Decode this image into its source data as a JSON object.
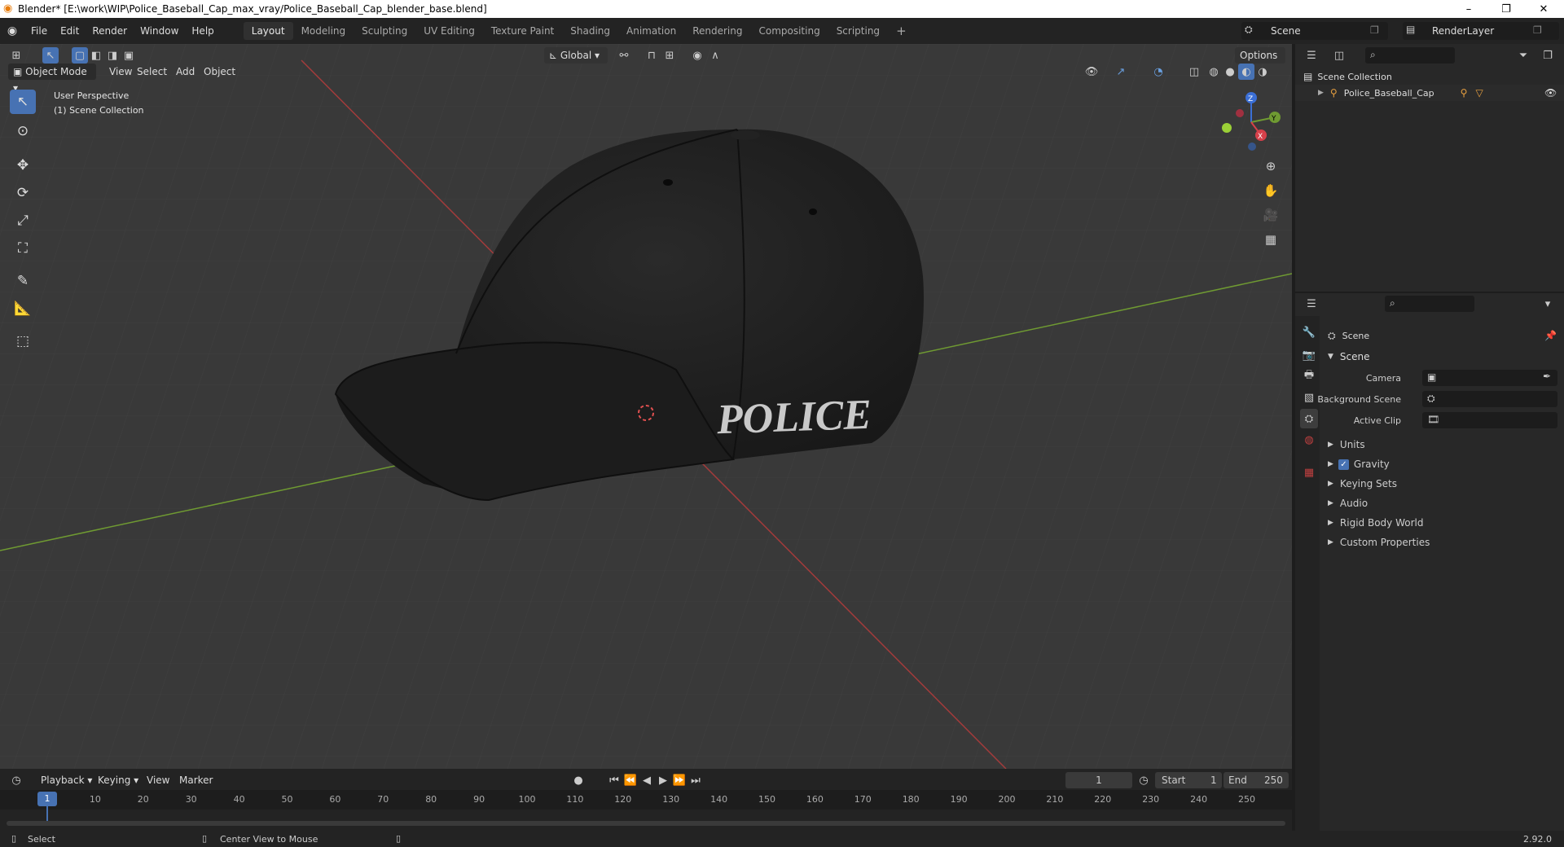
{
  "window": {
    "title": "Blender* [E:\\work\\WIP\\Police_Baseball_Cap_max_vray/Police_Baseball_Cap_blender_base.blend]",
    "minimize": "–",
    "maximize": "❐",
    "close": "✕"
  },
  "menus": [
    "File",
    "Edit",
    "Render",
    "Window",
    "Help"
  ],
  "workspaces": [
    "Layout",
    "Modeling",
    "Sculpting",
    "UV Editing",
    "Texture Paint",
    "Shading",
    "Animation",
    "Rendering",
    "Compositing",
    "Scripting"
  ],
  "active_workspace": "Layout",
  "add_tab": "+",
  "scene_selector": {
    "value": "Scene"
  },
  "renderlayer_selector": {
    "value": "RenderLayer"
  },
  "viewport": {
    "mode": "Object Mode",
    "menu": [
      "View",
      "Select",
      "Add",
      "Object"
    ],
    "orientation": "Global",
    "options": "Options",
    "overlay_line1": "User Perspective",
    "overlay_line2": "(1) Scene Collection",
    "cap_text": "POLICE",
    "axes": {
      "x": "X",
      "y": "Y",
      "z": "Z"
    },
    "colors": {
      "bg": "#393939",
      "x_axis": "#a33b3b",
      "y_axis": "#6f9a32",
      "accent": "#4772b3"
    }
  },
  "outliner": {
    "root": "Scene Collection",
    "items": [
      {
        "name": "Police_Baseball_Cap"
      }
    ]
  },
  "properties": {
    "context": "Scene",
    "section": "Scene",
    "fields": [
      {
        "label": "Camera",
        "value": ""
      },
      {
        "label": "Background Scene",
        "value": ""
      },
      {
        "label": "Active Clip",
        "value": ""
      }
    ],
    "panels": [
      "Units",
      "Gravity",
      "Keying Sets",
      "Audio",
      "Rigid Body World",
      "Custom Properties"
    ]
  },
  "timeline": {
    "menu": [
      "Playback",
      "Keying",
      "View",
      "Marker"
    ],
    "current_frame": "1",
    "start_label": "Start",
    "start": "1",
    "end_label": "End",
    "end": "250",
    "ticks": [
      "10",
      "20",
      "30",
      "40",
      "50",
      "60",
      "70",
      "80",
      "90",
      "100",
      "110",
      "120",
      "130",
      "140",
      "150",
      "160",
      "170",
      "180",
      "190",
      "200",
      "210",
      "220",
      "230",
      "240",
      "250"
    ]
  },
  "statusbar": {
    "left": "Select",
    "middle": "Center View to Mouse",
    "version": "2.92.0"
  }
}
